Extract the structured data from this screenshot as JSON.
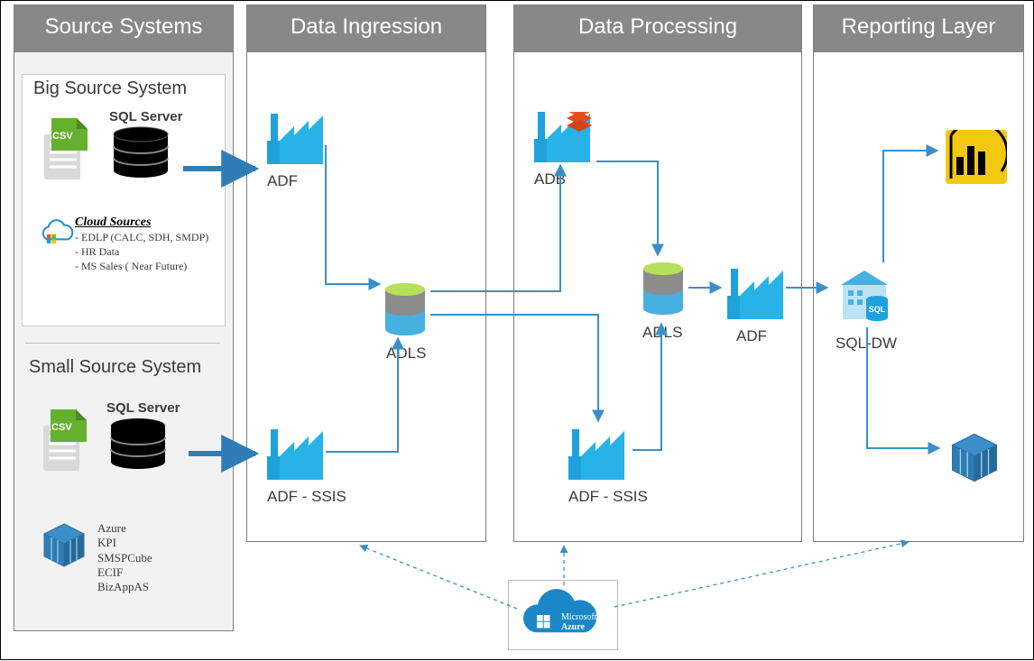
{
  "panels": {
    "source": {
      "title": "Source Systems"
    },
    "ingress": {
      "title": "Data Ingression"
    },
    "process": {
      "title": "Data Processing"
    },
    "report": {
      "title": "Reporting Layer"
    }
  },
  "source_big": {
    "title": "Big Source System",
    "csv_badge": ".CSV",
    "sql_label": "SQL Server",
    "cloud_title": "Cloud Sources",
    "cloud_items": [
      "- EDLP (CALC, SDH, SMDP)",
      "- HR Data",
      "- MS Sales ( Near Future)"
    ]
  },
  "source_small": {
    "title": "Small Source System",
    "csv_badge": ".CSV",
    "sql_label": "SQL Server",
    "cube_items": [
      "Azure",
      "KPI",
      "SMSPCube",
      "ECIF",
      "BizAppAS"
    ]
  },
  "ingress": {
    "adf_top": "ADF",
    "adls": "ADLS",
    "adf_ssis": "ADF - SSIS"
  },
  "process": {
    "adb": "ADB",
    "adls": "ADLS",
    "adf": "ADF",
    "adf_ssis": "ADF - SSIS"
  },
  "report": {
    "sqldw": "SQL-DW"
  },
  "footer_cloud": {
    "brand1": "Microsoft",
    "brand2": "Azure"
  }
}
